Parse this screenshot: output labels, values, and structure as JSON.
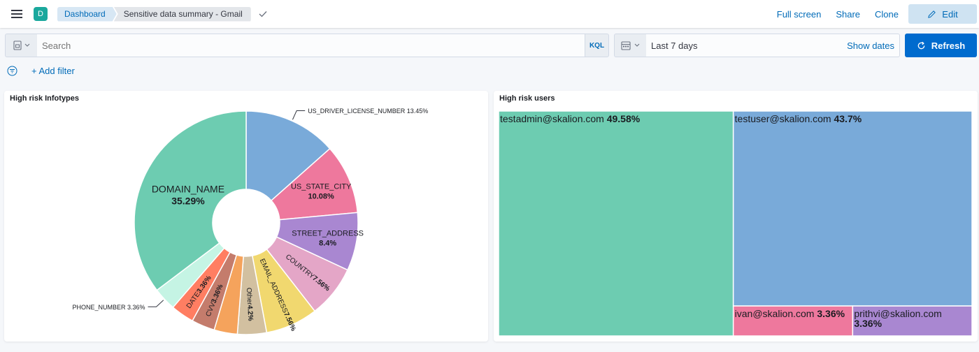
{
  "header": {
    "space_initial": "D",
    "breadcrumbs": [
      "Dashboard",
      "Sensitive data summary - Gmail"
    ],
    "actions": {
      "full_screen": "Full screen",
      "share": "Share",
      "clone": "Clone",
      "edit": "Edit"
    }
  },
  "query_bar": {
    "search_placeholder": "Search",
    "language": "KQL",
    "time_range": "Last 7 days",
    "show_dates": "Show dates",
    "refresh": "Refresh"
  },
  "filters": {
    "add_filter": "+ Add filter"
  },
  "panels": {
    "infotypes_title": "High risk Infotypes",
    "users_title": "High risk users"
  },
  "colors": {
    "brand": "#006bb8",
    "refresh_bg": "#006bce"
  },
  "chart_data": [
    {
      "type": "pie",
      "title": "High risk Infotypes",
      "donut": true,
      "slices": [
        {
          "name": "US_DRIVER_LICENSE_NUMBER",
          "percent": 13.45,
          "label": "13.45%",
          "color": "#79aad9"
        },
        {
          "name": "US_STATE_CITY",
          "percent": 10.08,
          "label": "10.08%",
          "color": "#ee789d"
        },
        {
          "name": "STREET_ADDRESS",
          "percent": 8.4,
          "label": "8.4%",
          "color": "#a987d1"
        },
        {
          "name": "COUNTRY",
          "percent": 7.56,
          "label": "7.56%",
          "color": "#e4a6c7"
        },
        {
          "name": "EMAIL_ADDRESS",
          "percent": 7.56,
          "label": "7.56%",
          "color": "#f1d86f"
        },
        {
          "name": "Other",
          "percent": 4.2,
          "label": "4.2%",
          "color": "#d2c0a0"
        },
        {
          "name": "",
          "percent": 3.36,
          "label": "",
          "color": "#f5a35c"
        },
        {
          "name": "CVV",
          "percent": 3.36,
          "label": "3.36%",
          "color": "#c47c6c"
        },
        {
          "name": "DATE",
          "percent": 3.36,
          "label": "3.36%",
          "color": "#ff7e62"
        },
        {
          "name": "PHONE_NUMBER",
          "percent": 3.36,
          "label": "3.36%",
          "color": "#c5f4e4"
        },
        {
          "name": "DOMAIN_NAME",
          "percent": 35.29,
          "label": "35.29%",
          "color": "#6dccb1"
        }
      ]
    },
    {
      "type": "treemap",
      "title": "High risk users",
      "items": [
        {
          "name": "testadmin@skalion.com",
          "percent": 49.58,
          "label": "49.58%",
          "color": "#6dccb1"
        },
        {
          "name": "testuser@skalion.com",
          "percent": 43.7,
          "label": "43.7%",
          "color": "#79aad9"
        },
        {
          "name": "ivan@skalion.com",
          "percent": 3.36,
          "label": "3.36%",
          "color": "#ee789d"
        },
        {
          "name": "prithvi@skalion.com",
          "percent": 3.36,
          "label": "3.36%",
          "color": "#a987d1"
        }
      ]
    }
  ]
}
